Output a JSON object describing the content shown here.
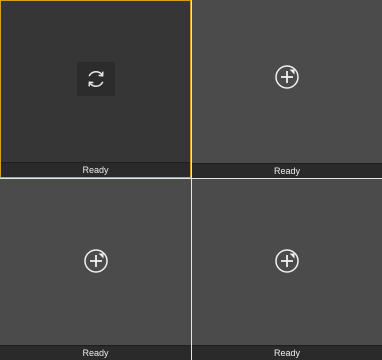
{
  "panes": [
    {
      "status": "Ready",
      "icon": "refresh-icon",
      "active": true
    },
    {
      "status": "Ready",
      "icon": "add-camera-icon",
      "active": false
    },
    {
      "status": "Ready",
      "icon": "add-camera-icon",
      "active": false
    },
    {
      "status": "Ready",
      "icon": "add-camera-icon",
      "active": false
    }
  ],
  "colors": {
    "active_border": "#d4a21a",
    "pane_bg": "#4b4b4b",
    "active_pane_bg": "#363636",
    "divider": "#e6e6e6"
  }
}
